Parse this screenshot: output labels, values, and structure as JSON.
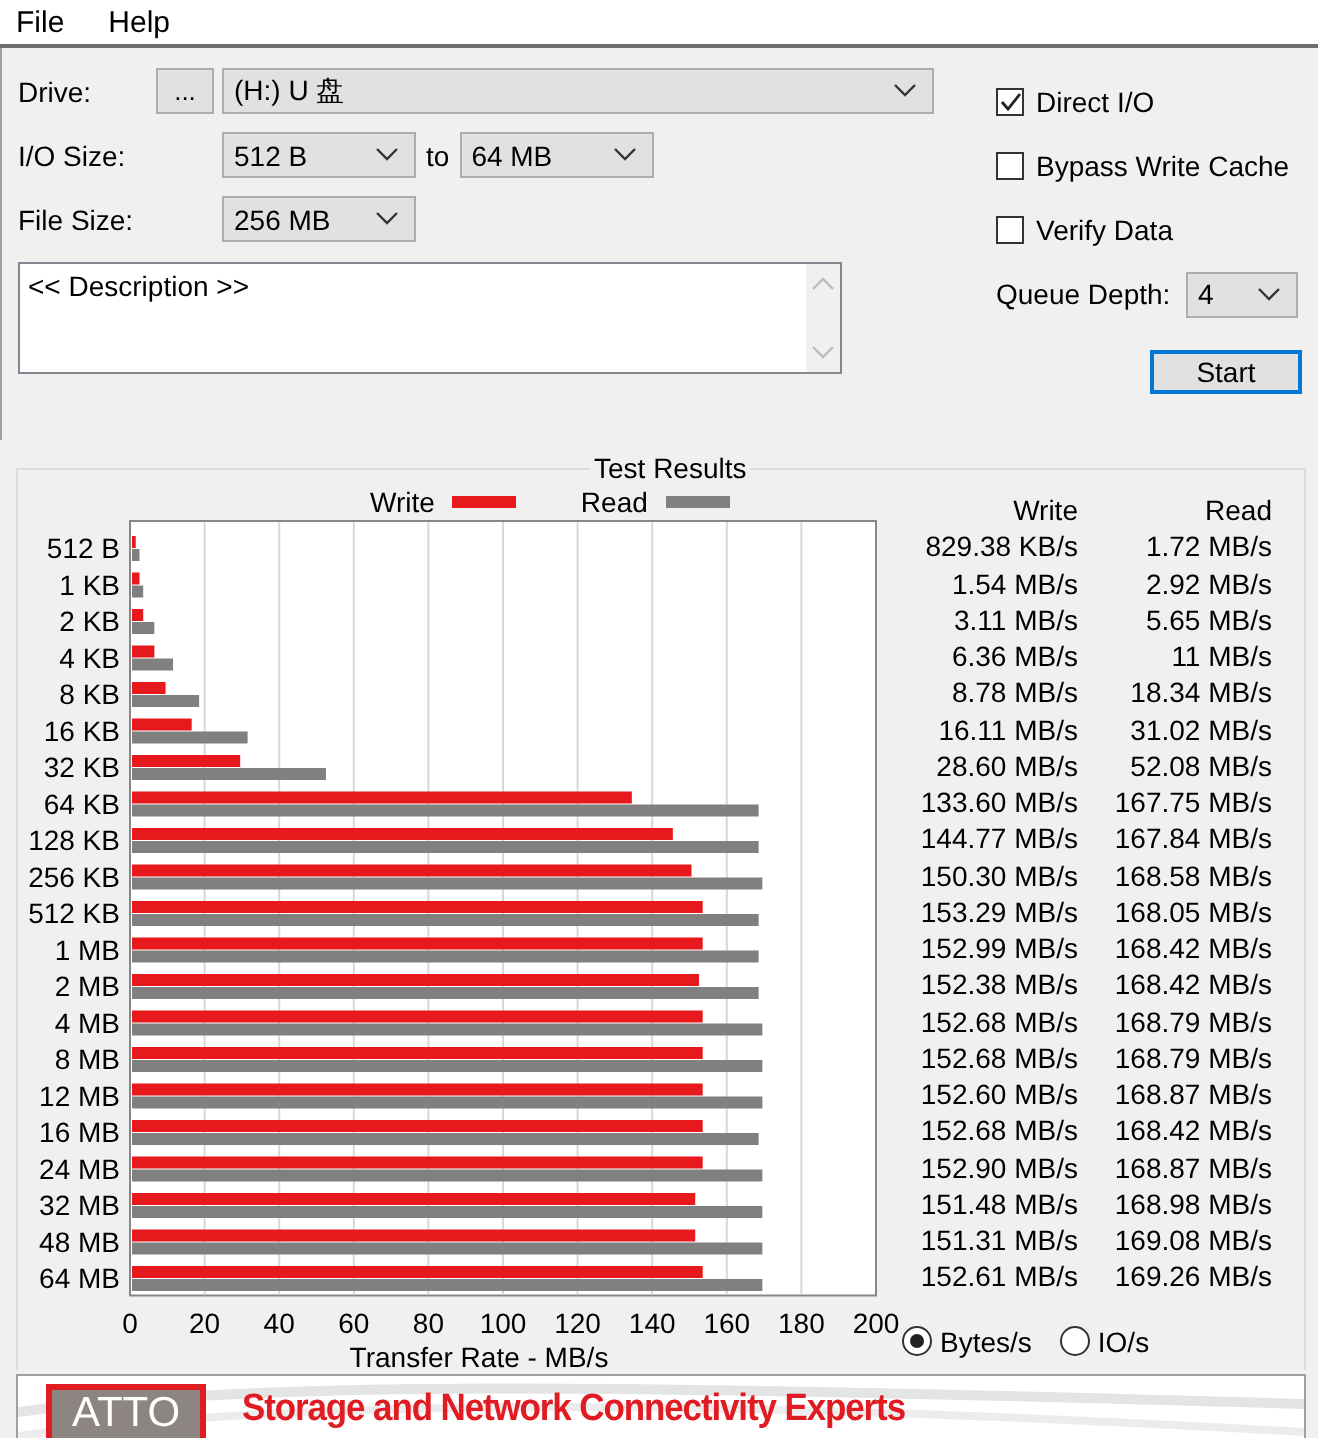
{
  "menu": [
    {
      "label": "File"
    },
    {
      "label": "Help"
    }
  ],
  "drive": {
    "label": "Drive:",
    "browse": "...",
    "value": "(H:) U 盘"
  },
  "io_size": {
    "label": "I/O Size:",
    "from": "512 B",
    "to_label": "to",
    "to": "64 MB"
  },
  "file_size": {
    "label": "File Size:",
    "value": "256 MB"
  },
  "options": [
    {
      "label": "Direct I/O",
      "checked": true
    },
    {
      "label": "Bypass Write Cache",
      "checked": false
    },
    {
      "label": "Verify Data",
      "checked": false
    }
  ],
  "queue_depth": {
    "label": "Queue Depth:",
    "value": "4"
  },
  "description": {
    "value": "<< Description >>"
  },
  "start_button": "Start",
  "results": {
    "title": "Test Results",
    "chart_data": {
      "type": "bar",
      "orientation": "horizontal",
      "xlabel": "Transfer Rate - MB/s",
      "xlim": [
        0,
        200
      ],
      "xticks": [
        0,
        20,
        40,
        60,
        80,
        100,
        120,
        140,
        160,
        180,
        200
      ],
      "categories": [
        "512 B",
        "1 KB",
        "2 KB",
        "4 KB",
        "8 KB",
        "16 KB",
        "32 KB",
        "64 KB",
        "128 KB",
        "256 KB",
        "512 KB",
        "1 MB",
        "2 MB",
        "4 MB",
        "8 MB",
        "12 MB",
        "16 MB",
        "24 MB",
        "32 MB",
        "48 MB",
        "64 MB"
      ],
      "series": [
        {
          "name": "Write",
          "color": "#e8191d",
          "values": [
            1,
            2,
            3,
            6,
            9,
            16,
            29,
            134,
            145,
            150,
            153,
            153,
            152,
            153,
            153,
            153,
            153,
            153,
            151,
            151,
            153
          ]
        },
        {
          "name": "Read",
          "color": "#808080",
          "values": [
            2,
            3,
            6,
            11,
            18,
            31,
            52,
            168,
            168,
            169,
            168,
            168,
            168,
            169,
            169,
            169,
            168,
            169,
            169,
            169,
            169
          ]
        }
      ],
      "grid": true
    },
    "table": {
      "columns": [
        "Write",
        "Read"
      ],
      "rows": [
        [
          "829.38 KB/s",
          "1.72 MB/s"
        ],
        [
          "1.54 MB/s",
          "2.92 MB/s"
        ],
        [
          "3.11 MB/s",
          "5.65 MB/s"
        ],
        [
          "6.36 MB/s",
          "11 MB/s"
        ],
        [
          "8.78 MB/s",
          "18.34 MB/s"
        ],
        [
          "16.11 MB/s",
          "31.02 MB/s"
        ],
        [
          "28.60 MB/s",
          "52.08 MB/s"
        ],
        [
          "133.60 MB/s",
          "167.75 MB/s"
        ],
        [
          "144.77 MB/s",
          "167.84 MB/s"
        ],
        [
          "150.30 MB/s",
          "168.58 MB/s"
        ],
        [
          "153.29 MB/s",
          "168.05 MB/s"
        ],
        [
          "152.99 MB/s",
          "168.42 MB/s"
        ],
        [
          "152.38 MB/s",
          "168.42 MB/s"
        ],
        [
          "152.68 MB/s",
          "168.79 MB/s"
        ],
        [
          "152.68 MB/s",
          "168.79 MB/s"
        ],
        [
          "152.60 MB/s",
          "168.87 MB/s"
        ],
        [
          "152.68 MB/s",
          "168.42 MB/s"
        ],
        [
          "152.90 MB/s",
          "168.87 MB/s"
        ],
        [
          "151.48 MB/s",
          "168.98 MB/s"
        ],
        [
          "151.31 MB/s",
          "169.08 MB/s"
        ],
        [
          "152.61 MB/s",
          "169.26 MB/s"
        ]
      ]
    },
    "units": [
      {
        "label": "Bytes/s",
        "selected": true
      },
      {
        "label": "IO/s",
        "selected": false
      }
    ]
  },
  "banner": {
    "logo": "ATTO",
    "tagline": "Storage and Network Connectivity Experts"
  }
}
